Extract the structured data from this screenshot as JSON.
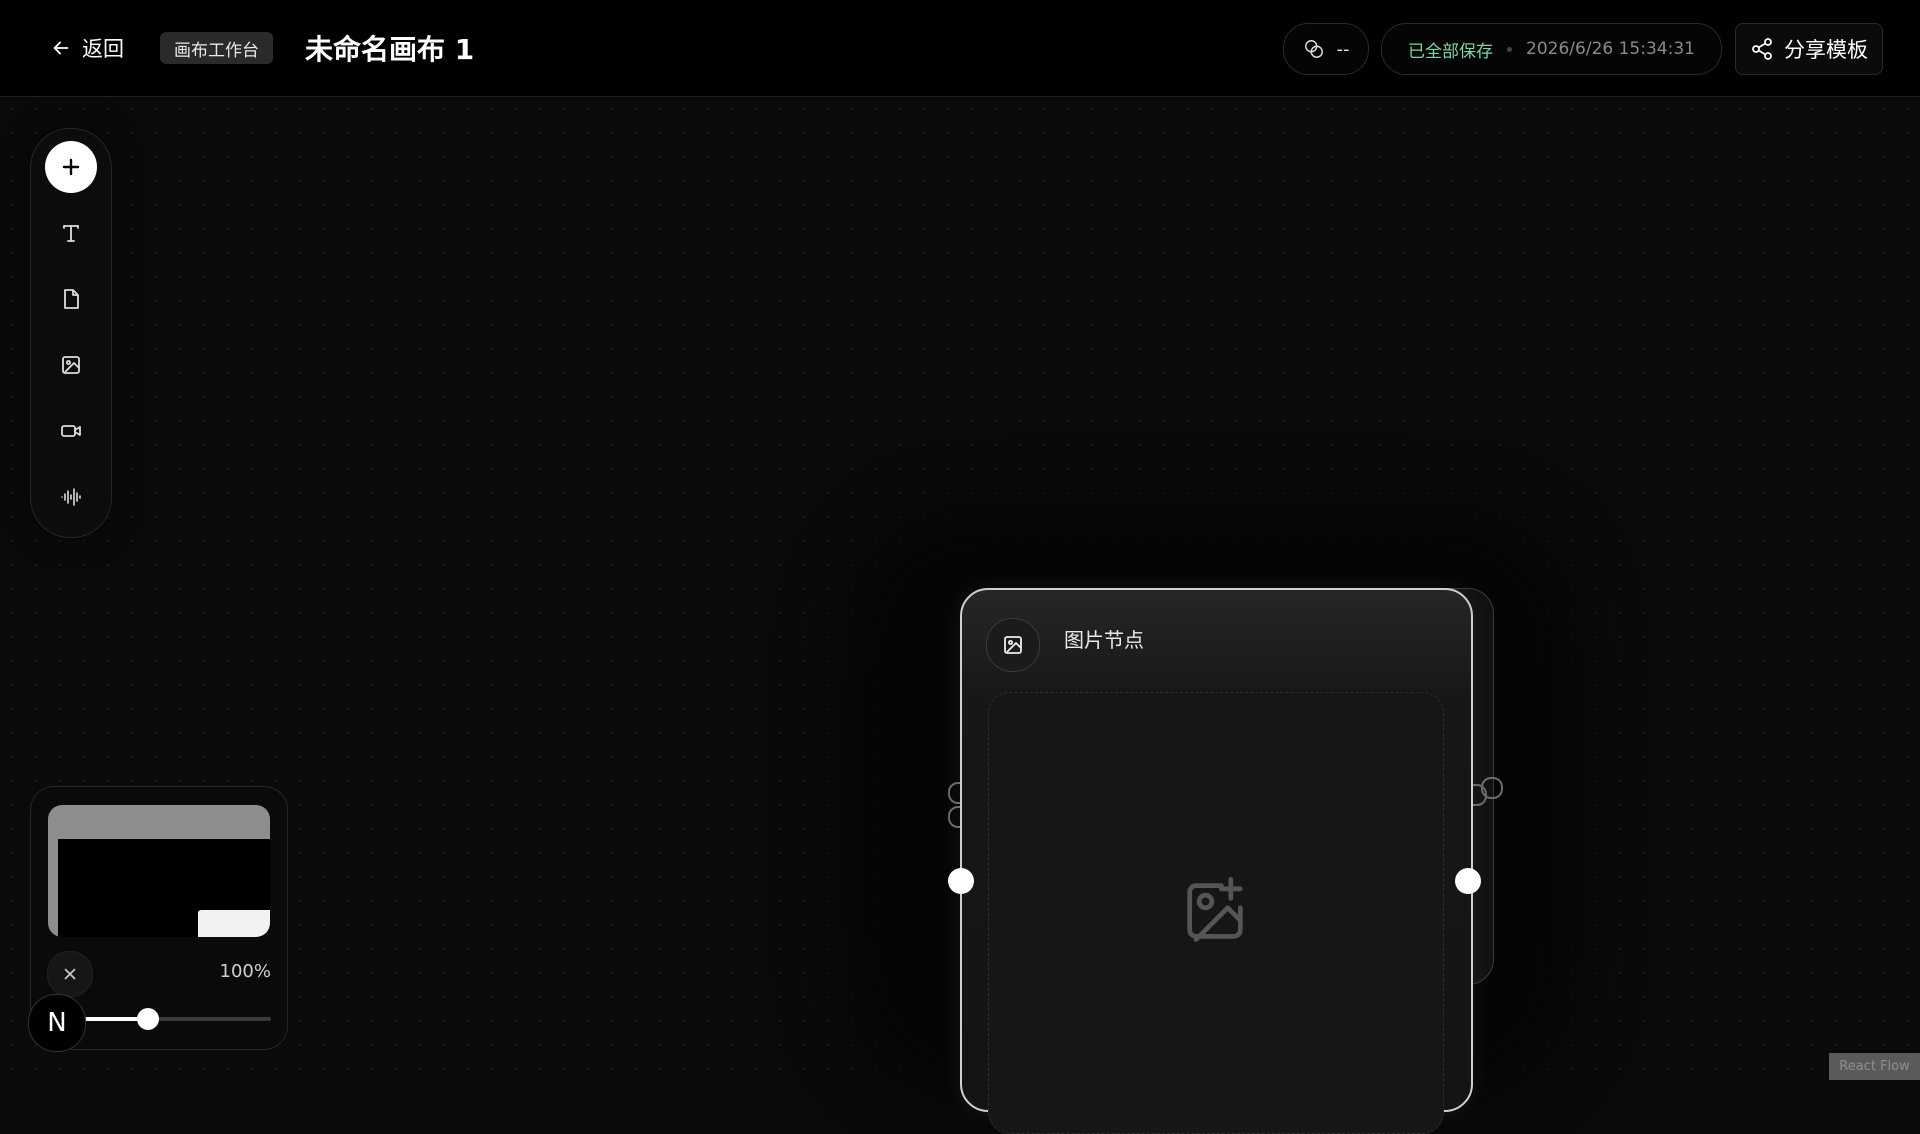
{
  "header": {
    "back_label": "返回",
    "workspace_tag": "画布工作台",
    "title": "未命名画布 1",
    "credit_value": "--",
    "save_status": "已全部保存",
    "save_time": "2026/6/26 15:34:31",
    "share_label": "分享模板"
  },
  "toolbar": {
    "tools": [
      "add-icon",
      "text-icon",
      "document-icon",
      "image-icon",
      "video-icon",
      "audio-icon"
    ]
  },
  "minimap_panel": {
    "zoom_label": "100%",
    "zoom_level": 0.32
  },
  "badge": {
    "letter": "N"
  },
  "node": {
    "title": "图片节点",
    "icon": "image-icon",
    "placeholder_icon": "image-add-icon"
  },
  "watermark": "React Flow",
  "colors": {
    "background": "#0a0a0a",
    "save_status": "#7fd6a0",
    "accent": "#ffffff"
  }
}
